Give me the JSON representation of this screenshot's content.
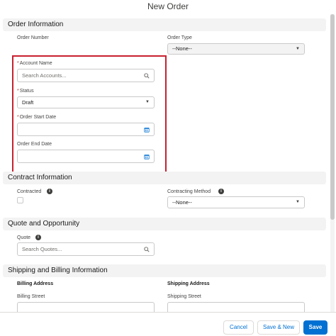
{
  "modal": {
    "title": "New Order"
  },
  "sections": {
    "order_information": "Order Information",
    "contract_information": "Contract Information",
    "quote_and_opportunity": "Quote and Opportunity",
    "shipping_billing": "Shipping and Billing Information"
  },
  "fields": {
    "order_number_label": "Order Number",
    "order_type_label": "Order Type",
    "order_type_value": "--None--",
    "account_name_label": "Account Name",
    "account_name_placeholder": "Search Accounts...",
    "status_label": "Status",
    "status_value": "Draft",
    "order_start_date_label": "Order Start Date",
    "order_end_date_label": "Order End Date",
    "contracted_label": "Contracted",
    "contracting_method_label": "Contracting Method",
    "contracting_method_value": "--None--",
    "quote_label": "Quote",
    "quote_placeholder": "Search Quotes...",
    "billing_address_label": "Billing Address",
    "shipping_address_label": "Shipping Address",
    "billing_street_label": "Billing Street",
    "shipping_street_label": "Shipping Street",
    "required_marker": "*"
  },
  "footer": {
    "cancel_label": "Cancel",
    "save_new_label": "Save & New",
    "save_label": "Save"
  },
  "colors": {
    "brand": "#0070d2",
    "highlight": "#c8202f",
    "required": "#c23934"
  },
  "icons": {
    "search": "search-icon",
    "calendar": "calendar-icon",
    "dropdown": "chevron-down-icon",
    "info": "info-icon"
  }
}
